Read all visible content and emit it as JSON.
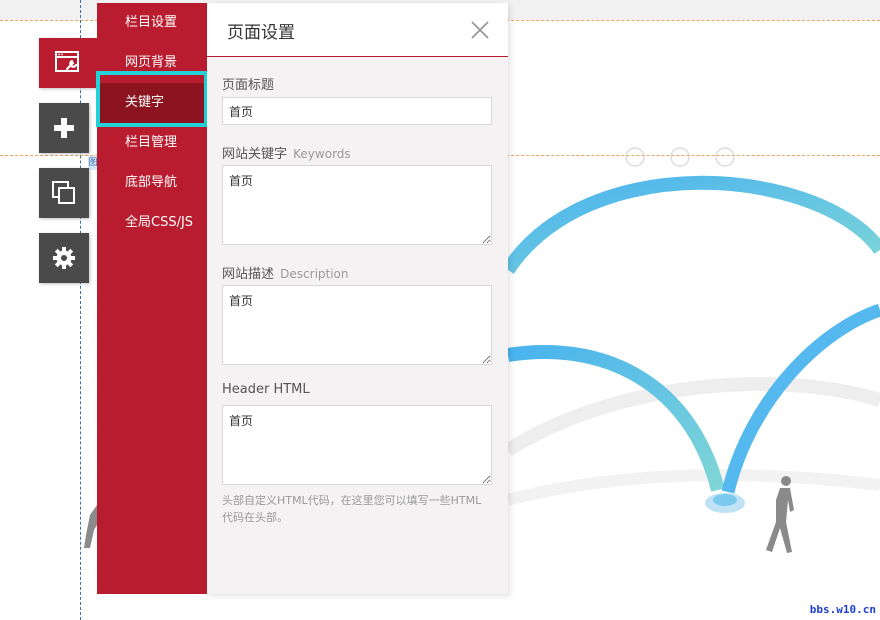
{
  "left_tools": [
    {
      "name": "page-settings",
      "icon": "window-wrench-icon",
      "active": true
    },
    {
      "name": "add",
      "icon": "plus-icon",
      "active": false
    },
    {
      "name": "layers",
      "icon": "copy-icon",
      "active": false
    },
    {
      "name": "settings",
      "icon": "gear-icon",
      "active": false
    }
  ],
  "nav": {
    "items": [
      {
        "label": "栏目设置"
      },
      {
        "label": "网页背景"
      },
      {
        "label": "关键字"
      },
      {
        "label": "栏目管理"
      },
      {
        "label": "底部导航"
      },
      {
        "label": "全局CSS/JS"
      }
    ],
    "selected_index": 2
  },
  "panel": {
    "title": "页面设置",
    "close_icon": "close-icon",
    "page_title": {
      "label": "页面标题",
      "value": "首页"
    },
    "keywords": {
      "label": "网站关键字",
      "label_en": "Keywords",
      "value": "首页"
    },
    "description": {
      "label": "网站描述",
      "label_en": "Description",
      "value": "首页"
    },
    "header_html": {
      "label": "Header HTML",
      "value": "首页"
    },
    "hint": "头部自定义HTML代码，在这里您可以填写一些HTML代码在头部。"
  },
  "canvas": {
    "edit_tag": "图"
  },
  "watermark": "bbs.w10.cn",
  "colors": {
    "accent_red": "#b91c2e",
    "selected_red": "#8c1320",
    "highlight_cyan": "#22d2d6",
    "tool_gray": "#4a4a4a",
    "arc_blue": "#55b8ee",
    "arc_teal": "#7fd0dc"
  }
}
